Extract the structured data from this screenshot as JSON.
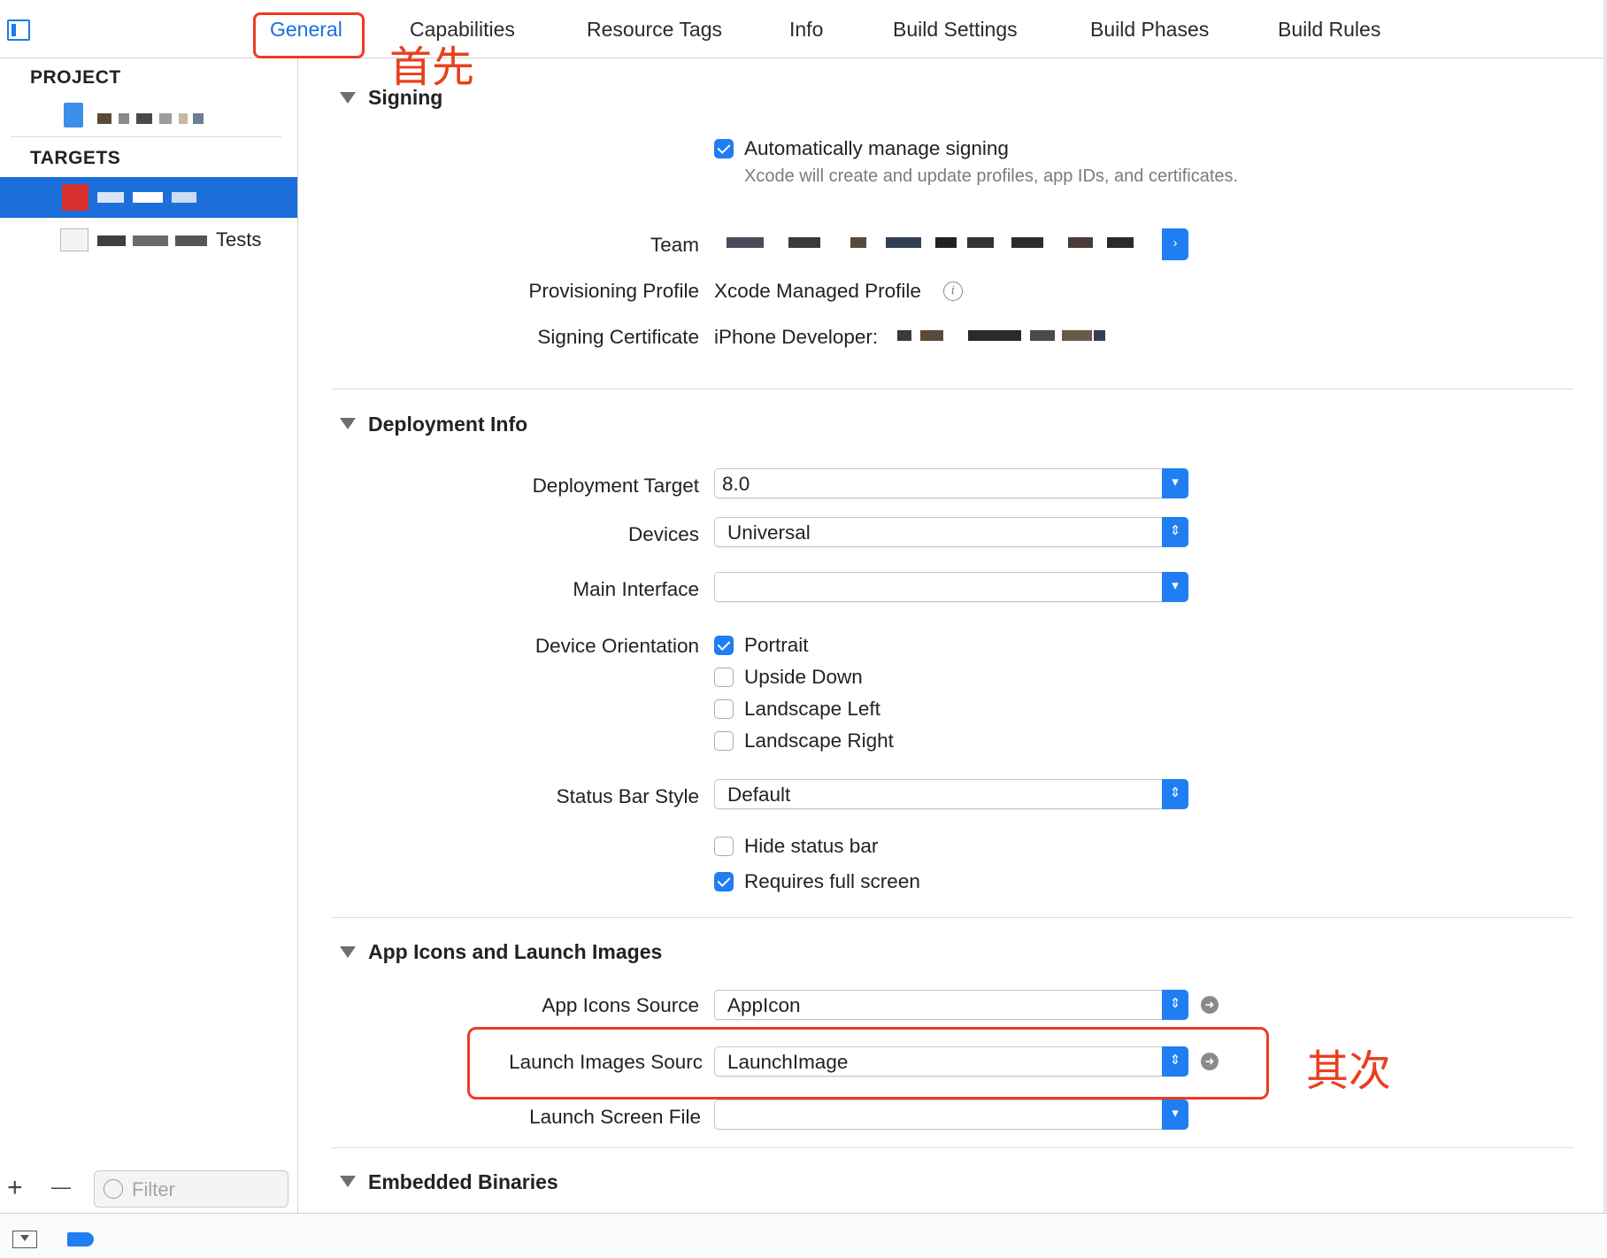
{
  "tabs": [
    {
      "label": "General",
      "active": true
    },
    {
      "label": "Capabilities"
    },
    {
      "label": "Resource Tags"
    },
    {
      "label": "Info"
    },
    {
      "label": "Build Settings"
    },
    {
      "label": "Build Phases"
    },
    {
      "label": "Build Rules"
    }
  ],
  "annotations": {
    "first": "首先",
    "second": "其次"
  },
  "navigator": {
    "project_header": "PROJECT",
    "targets_header": "TARGETS",
    "tests_suffix": "Tests",
    "filter_placeholder": "Filter",
    "add_symbol": "+",
    "remove_symbol": "—"
  },
  "signing": {
    "title": "Signing",
    "auto_manage": {
      "label": "Automatically manage signing",
      "checked": true
    },
    "auto_manage_hint": "Xcode will create and update profiles, app IDs, and certificates.",
    "team_label": "Team",
    "provisioning_label": "Provisioning Profile",
    "provisioning_value": "Xcode Managed Profile",
    "certificate_label": "Signing Certificate",
    "certificate_value": "iPhone Developer:"
  },
  "deployment": {
    "title": "Deployment Info",
    "target_label": "Deployment Target",
    "target_value": "8.0",
    "devices_label": "Devices",
    "devices_value": "Universal",
    "main_interface_label": "Main Interface",
    "main_interface_value": "",
    "orientation_label": "Device Orientation",
    "orientations": [
      {
        "label": "Portrait",
        "checked": true
      },
      {
        "label": "Upside Down",
        "checked": false
      },
      {
        "label": "Landscape Left",
        "checked": false
      },
      {
        "label": "Landscape Right",
        "checked": false
      }
    ],
    "status_bar_label": "Status Bar Style",
    "status_bar_value": "Default",
    "hide_status_bar": {
      "label": "Hide status bar",
      "checked": false
    },
    "requires_full_screen": {
      "label": "Requires full screen",
      "checked": true
    }
  },
  "app_icons": {
    "title": "App Icons and Launch Images",
    "icons_source_label": "App Icons Source",
    "icons_source_value": "AppIcon",
    "launch_images_label": "Launch Images Sourc",
    "launch_images_value": "LaunchImage",
    "launch_screen_label": "Launch Screen File",
    "launch_screen_value": ""
  },
  "embedded": {
    "title": "Embedded Binaries"
  },
  "colors": {
    "accent": "#1f7ef2",
    "annotation": "#ee3b22",
    "selection": "#1c6fdb"
  }
}
